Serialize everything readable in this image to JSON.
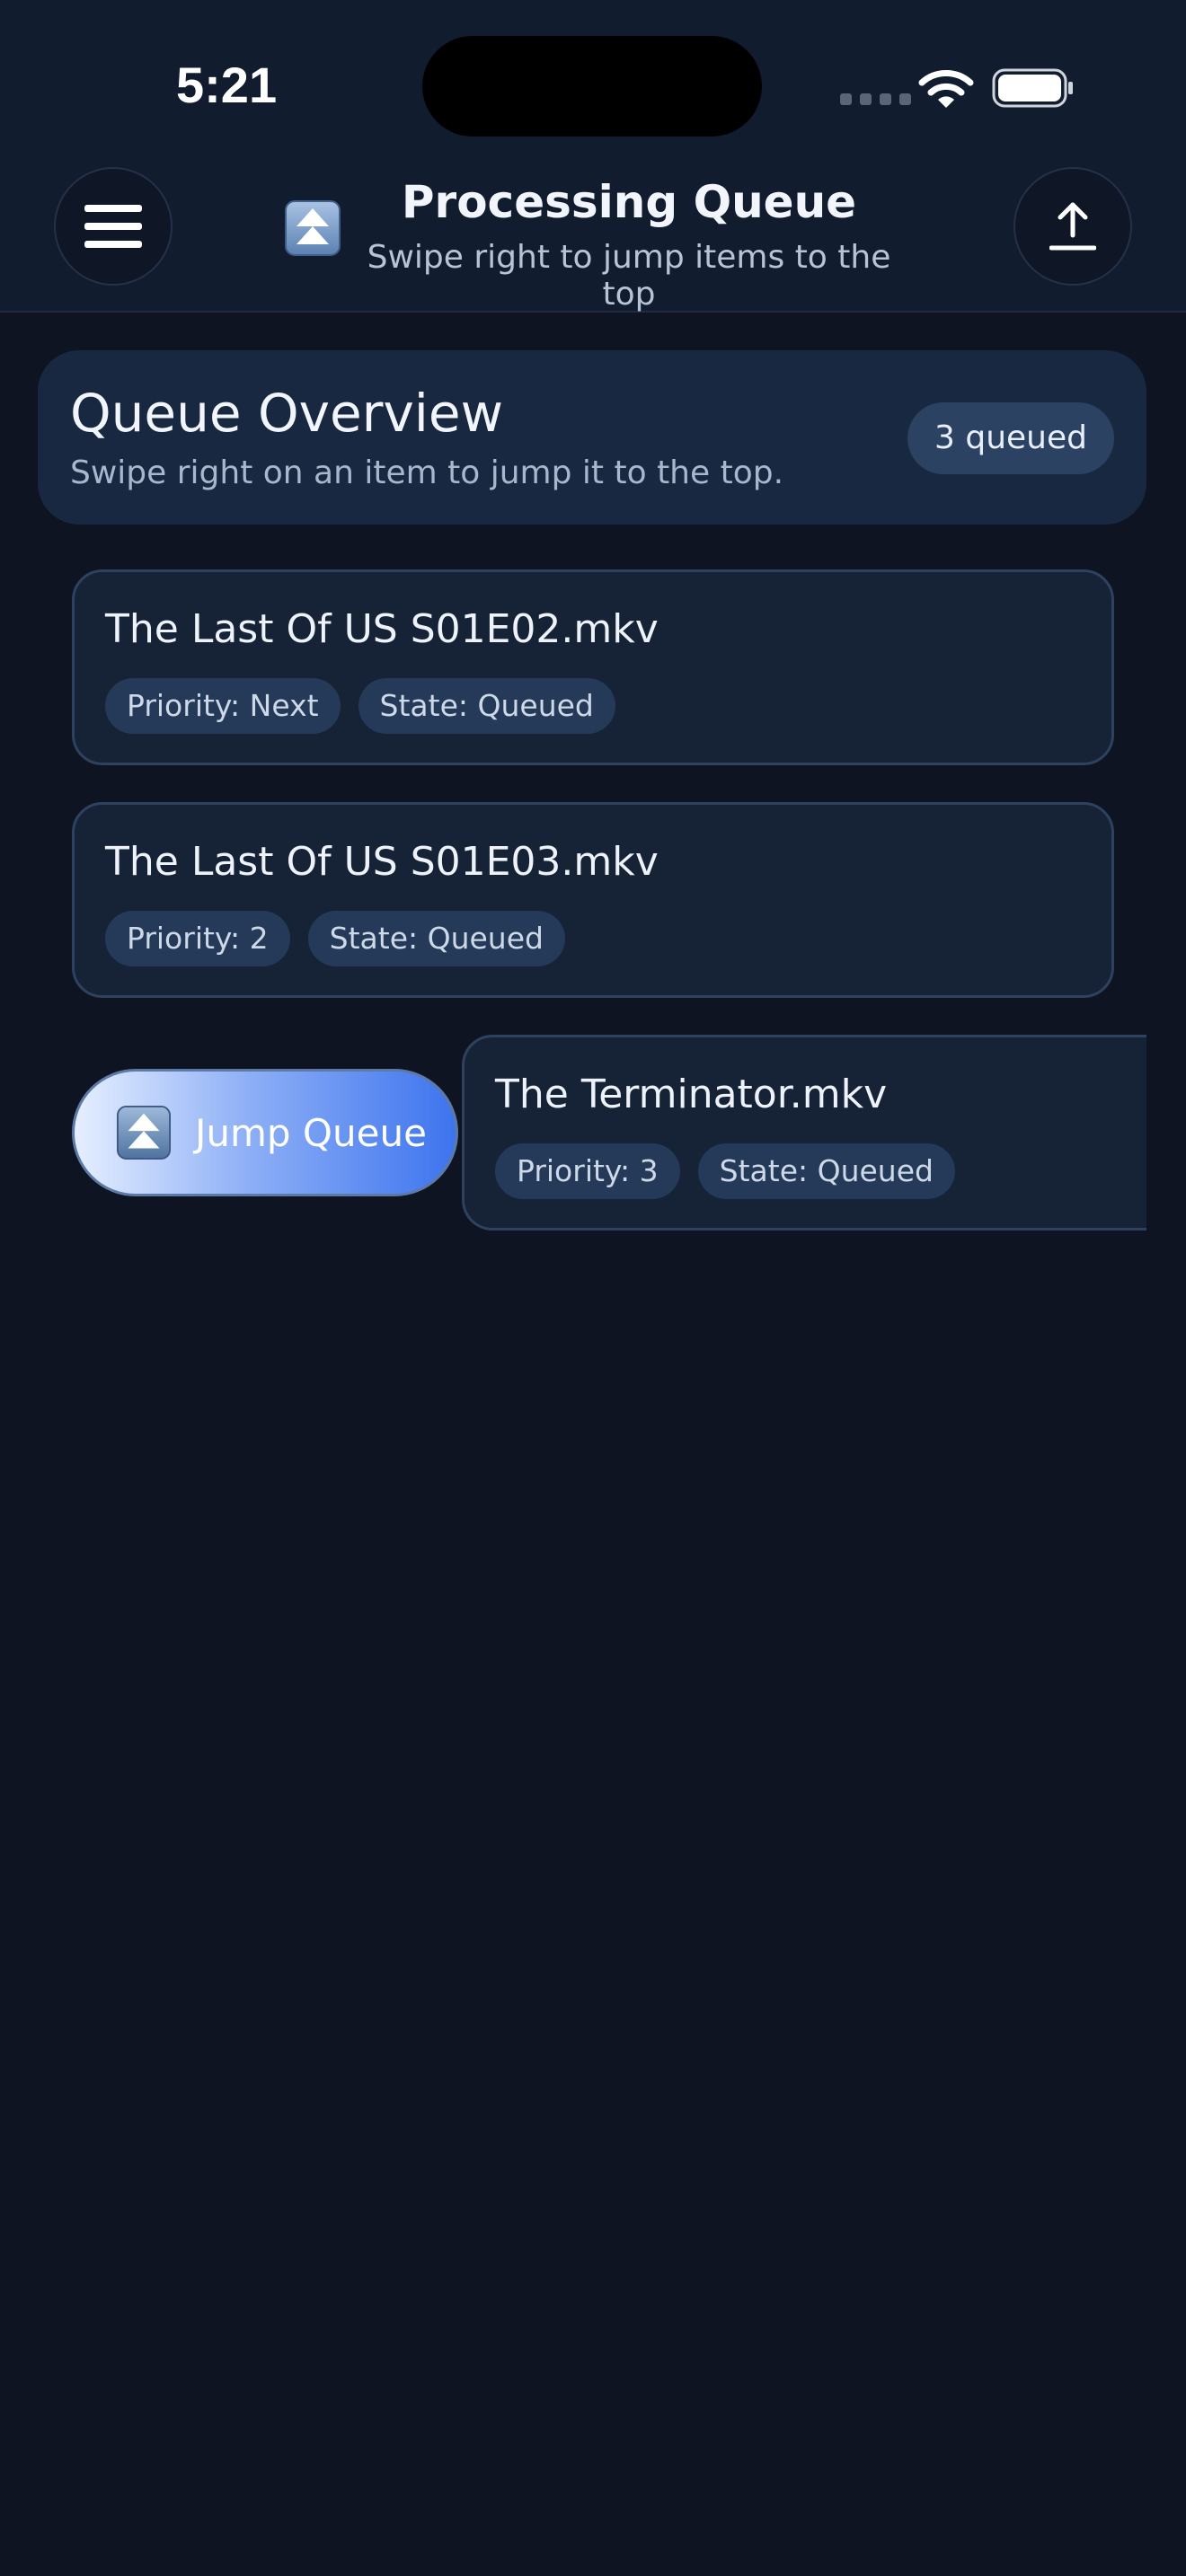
{
  "status_bar": {
    "time": "5:21"
  },
  "header": {
    "title": "Processing Queue",
    "subtitle": "Swipe right to jump items to the top",
    "menu_icon": "hamburger-menu-icon",
    "title_icon": "double-up-arrow-icon",
    "upload_icon": "upload-icon"
  },
  "overview": {
    "title": "Queue Overview",
    "description": "Swipe right on an item to jump it to the top.",
    "count_badge": "3 queued"
  },
  "queue": [
    {
      "name": "The Last Of US S01E02.mkv",
      "priority": "Priority: Next",
      "state": "State: Queued"
    },
    {
      "name": "The Last Of US S01E03.mkv",
      "priority": "Priority: 2",
      "state": "State: Queued"
    },
    {
      "name": "The Terminator.mkv",
      "priority": "Priority: 3",
      "state": "State: Queued"
    }
  ],
  "swipe_action": {
    "label": "Jump Queue",
    "icon": "double-up-arrow-icon"
  },
  "colors": {
    "background": "#0e1422",
    "card": "#162235",
    "accent": "#3d74ee",
    "chip": "#253a58"
  }
}
